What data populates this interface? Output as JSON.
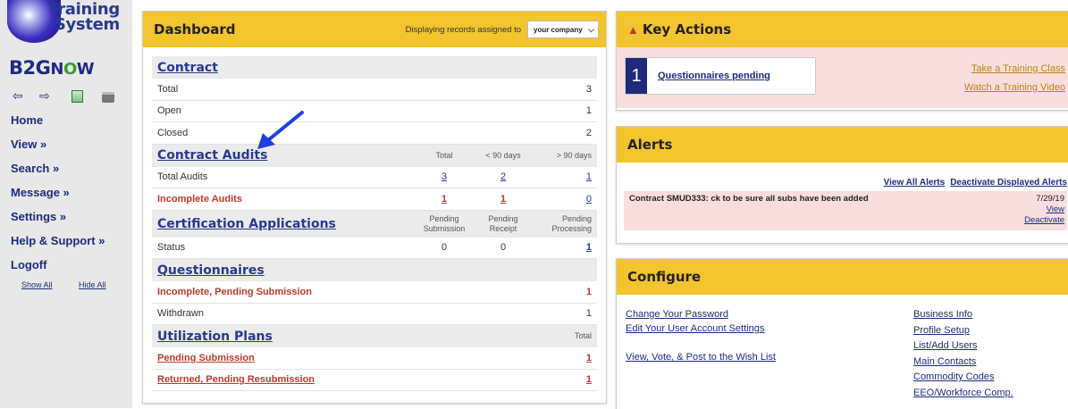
{
  "sidebar": {
    "logo_line1": "Training",
    "logo_line2": "System",
    "brand_b2g": "B2G",
    "brand_o": "O",
    "brand_n": "N",
    "brand_w": "W",
    "nav": [
      {
        "label": "Home"
      },
      {
        "label": "View »"
      },
      {
        "label": "Search »"
      },
      {
        "label": "Message »"
      },
      {
        "label": "Settings »"
      },
      {
        "label": "Help & Support »"
      },
      {
        "label": "Logoff"
      }
    ],
    "show_all": "Show All",
    "hide_all": "Hide All"
  },
  "dashboard": {
    "title": "Dashboard",
    "displaying_label": "Displaying records assigned to",
    "company_selected": "your company",
    "contract": {
      "heading": "Contract",
      "rows": [
        {
          "label": "Total",
          "value": "3"
        },
        {
          "label": "Open",
          "value": "1"
        },
        {
          "label": "Closed",
          "value": "2"
        }
      ]
    },
    "audits": {
      "heading": "Contract Audits",
      "col1": "Total",
      "col2": "< 90 days",
      "col3": "> 90 days",
      "total_label": "Total Audits",
      "total_values": [
        "3",
        "2",
        "1"
      ],
      "incomplete_label": "Incomplete Audits",
      "incomplete_values": [
        "1",
        "1",
        "0"
      ]
    },
    "certification": {
      "heading": "Certification Applications",
      "col1a": "Pending",
      "col1b": "Submission",
      "col2a": "Pending",
      "col2b": "Receipt",
      "col3a": "Pending",
      "col3b": "Processing",
      "status_label": "Status",
      "status_values": [
        "0",
        "0",
        "1"
      ]
    },
    "questionnaires": {
      "heading": "Questionnaires",
      "incomplete_label": "Incomplete, Pending Submission",
      "incomplete_value": "1",
      "withdrawn_label": "Withdrawn",
      "withdrawn_value": "1"
    },
    "utilization": {
      "heading": "Utilization Plans",
      "col": "Total",
      "pending_label": "Pending Submission",
      "pending_value": "1",
      "returned_label": "Returned, Pending Resubmission",
      "returned_value": "1"
    }
  },
  "key_actions": {
    "title": "Key Actions",
    "count": "1",
    "label": "Questionnaires pending",
    "link1": "Take a Training Class",
    "link2": "Watch a Training Video"
  },
  "alerts": {
    "title": "Alerts",
    "view_all": "View All Alerts",
    "deactivate_displayed": "Deactivate Displayed Alerts",
    "message": "Contract SMUD333: ck to be sure all subs have been added",
    "date": "7/29/19",
    "view": "View",
    "deactivate": "Deactivate"
  },
  "configure": {
    "title": "Configure",
    "left_links": [
      "Change Your Password",
      "Edit Your User Account Settings",
      "View, Vote, & Post to the Wish List"
    ],
    "right_links": [
      "Business Info",
      "Profile Setup",
      "List/Add Users",
      "Main Contacts",
      "Commodity Codes",
      "EEO/Workforce Comp."
    ]
  },
  "colors": {
    "header_yellow": "#f2c42d",
    "link_blue": "#1b2c80",
    "alert_red": "#c0392b",
    "pink_bg": "#f9dedd",
    "annotation_arrow": "#1f3fe0"
  },
  "icons": [
    "globe-logo-icon",
    "back-arrow-icon",
    "forward-arrow-icon",
    "refresh-icon",
    "print-icon",
    "warning-icon",
    "chevron-down-icon",
    "annotation-arrow-icon"
  ]
}
